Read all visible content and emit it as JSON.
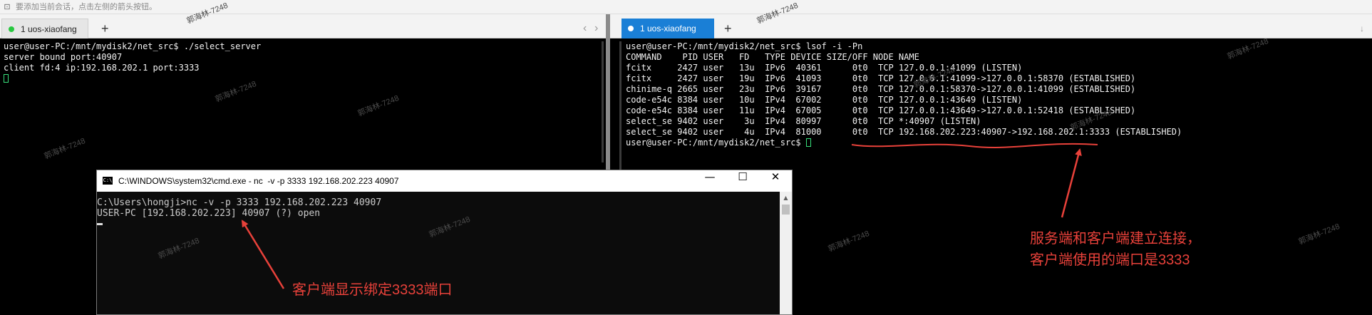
{
  "hint_bar": {
    "text": "要添加当前会话，点击左侧的箭头按钮。",
    "icon": "terminal-icon"
  },
  "left_tabs": {
    "tab_label": "1 uos-xiaofang",
    "add": "+"
  },
  "right_tabs": {
    "tab_label": "1 uos-xiaofang",
    "add": "+",
    "nav_prev": "‹",
    "nav_next": "›",
    "nav_arrow": "↓"
  },
  "left_terminal": {
    "lines": [
      "user@user-PC:/mnt/mydisk2/net_src$ ./select_server",
      "server bound port:40907",
      "client fd:4 ip:192.168.202.1 port:3333"
    ]
  },
  "right_terminal": {
    "lines": [
      "user@user-PC:/mnt/mydisk2/net_src$ lsof -i -Pn",
      "COMMAND    PID USER   FD   TYPE DEVICE SIZE/OFF NODE NAME",
      "fcitx     2427 user   13u  IPv6  40361      0t0  TCP 127.0.0.1:41099 (LISTEN)",
      "fcitx     2427 user   19u  IPv6  41093      0t0  TCP 127.0.0.1:41099->127.0.0.1:58370 (ESTABLISHED)",
      "chinime-q 2665 user   23u  IPv6  39167      0t0  TCP 127.0.0.1:58370->127.0.0.1:41099 (ESTABLISHED)",
      "code-e54c 8384 user   10u  IPv4  67002      0t0  TCP 127.0.0.1:43649 (LISTEN)",
      "code-e54c 8384 user   11u  IPv4  67005      0t0  TCP 127.0.0.1:43649->127.0.0.1:52418 (ESTABLISHED)",
      "select_se 9402 user    3u  IPv4  80997      0t0  TCP *:40907 (LISTEN)",
      "select_se 9402 user    4u  IPv4  81000      0t0  TCP 192.168.202.223:40907->192.168.202.1:3333 (ESTABLISHED)",
      "user@user-PC:/mnt/mydisk2/net_src$ "
    ]
  },
  "cmd_window": {
    "title": "C:\\WINDOWS\\system32\\cmd.exe - nc  -v -p 3333 192.168.202.223 40907",
    "minimize": "—",
    "maximize": "☐",
    "close": "✕",
    "lines": [
      "C:\\Users\\hongji>nc -v -p 3333 192.168.202.223 40907",
      "USER-PC [192.168.202.223] 40907 (?) open"
    ]
  },
  "annotations": {
    "client": "客户端显示绑定3333端口",
    "server_line1": "服务端和客户端建立连接，",
    "server_line2": "客户端使用的端口是3333"
  },
  "watermark": "郭海林-7248",
  "colors": {
    "annotation": "#e8413a",
    "tab_active": "#1a7fd6",
    "session_dot": "#28c840",
    "cursor": "#38e07b"
  }
}
